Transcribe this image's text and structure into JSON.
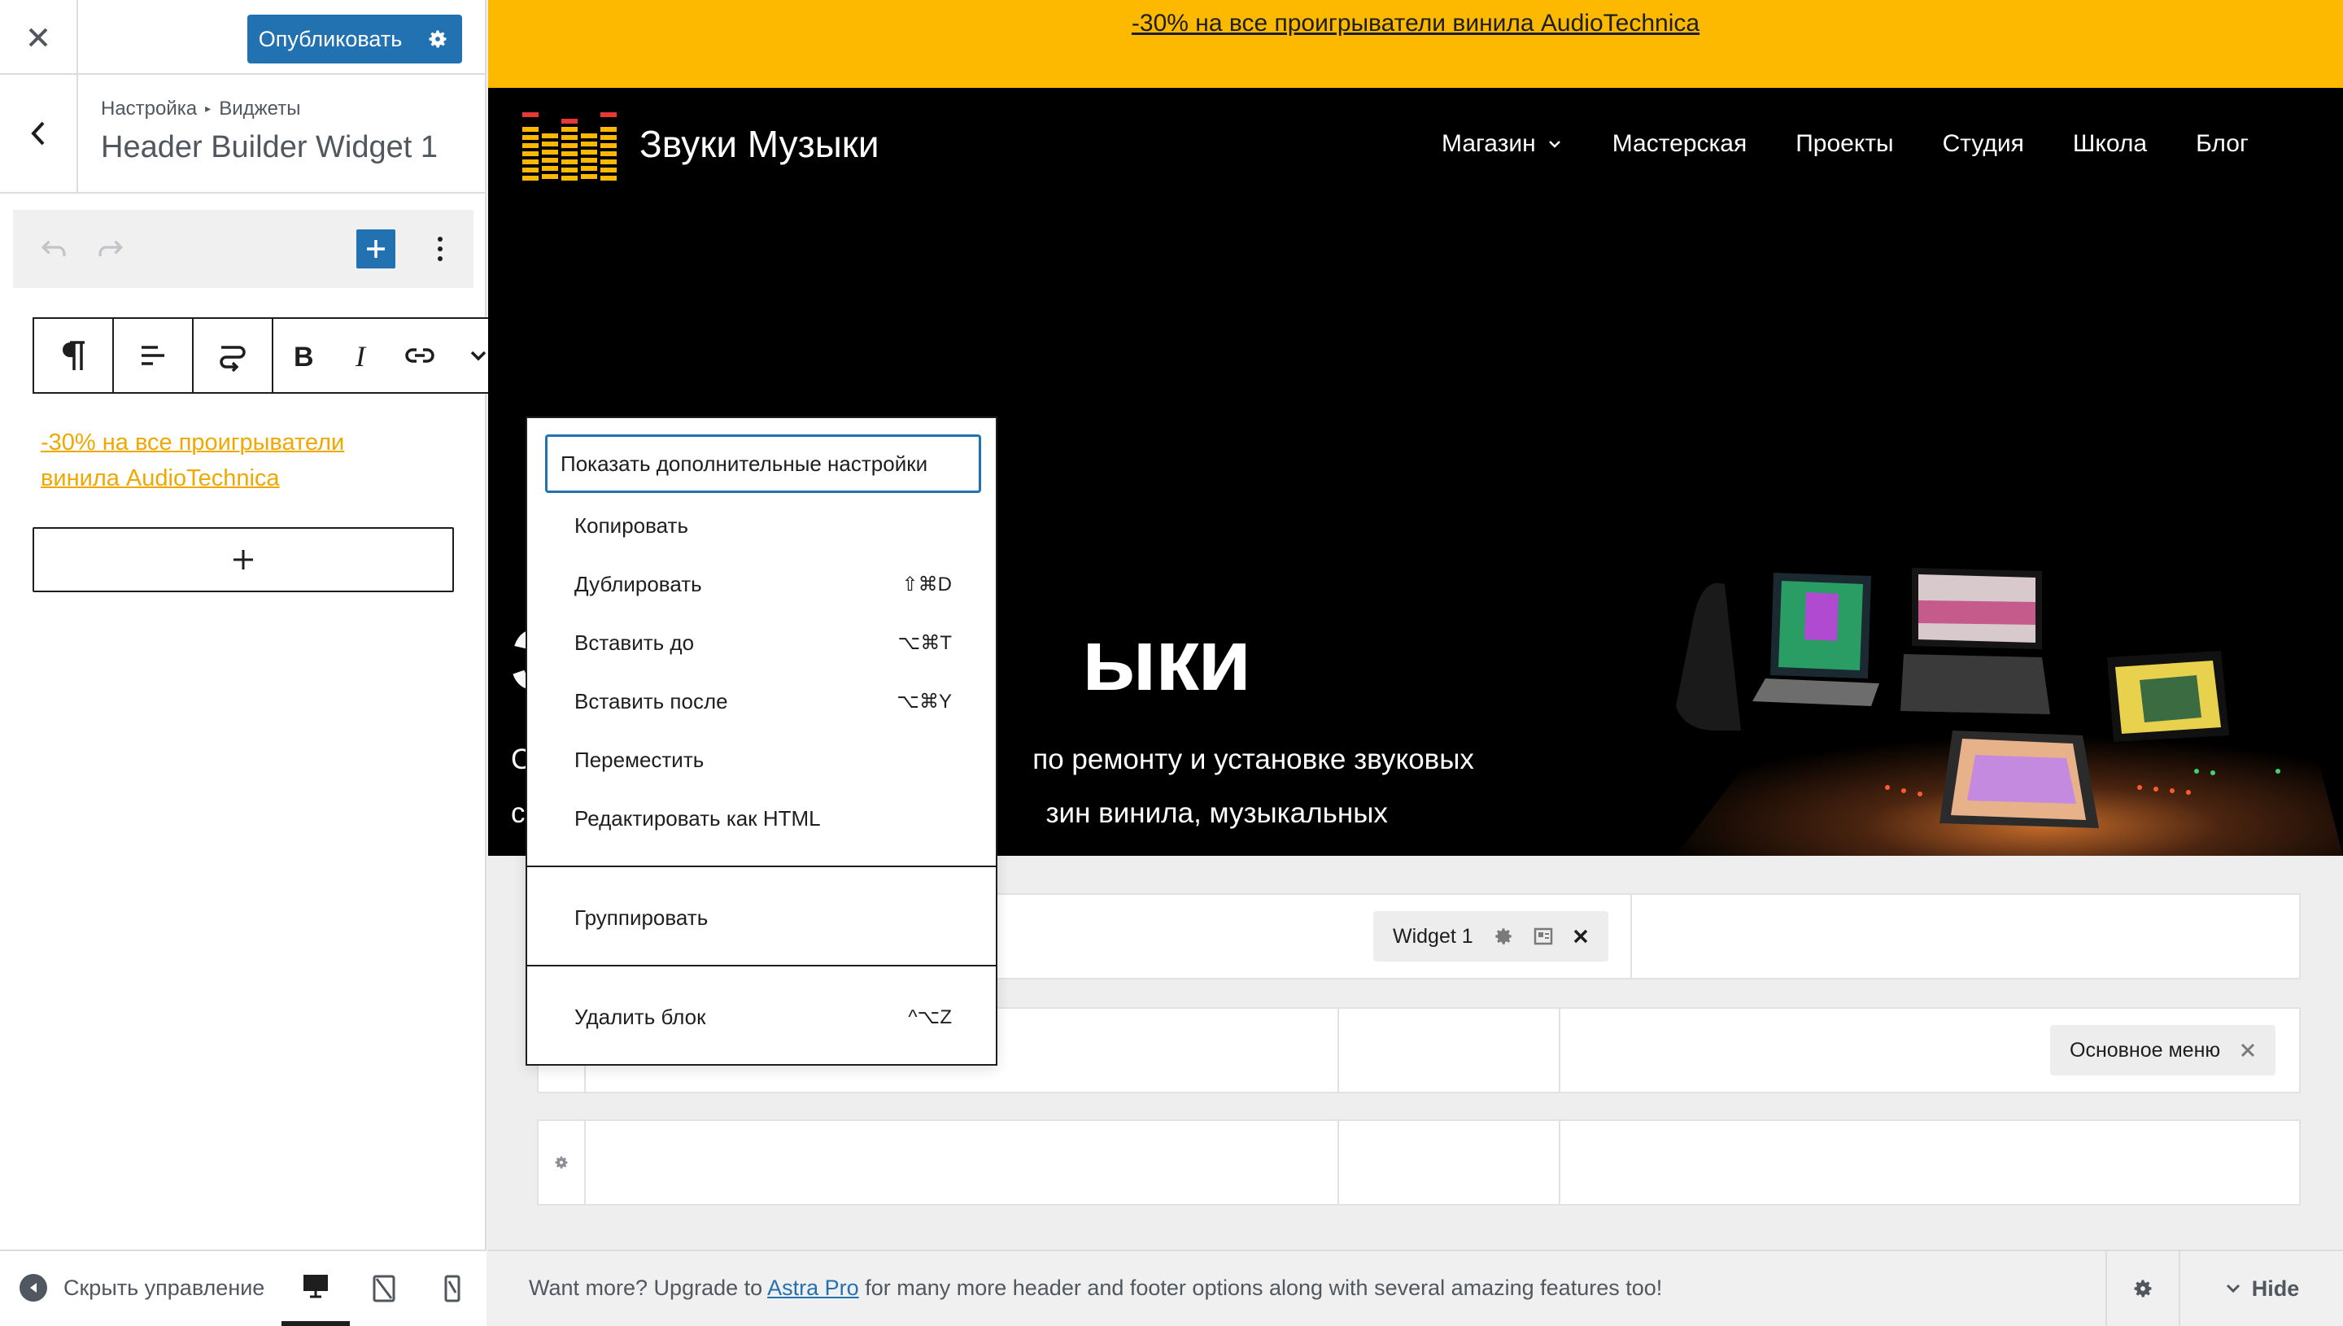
{
  "sidebar": {
    "publish_label": "Опубликовать",
    "breadcrumb": [
      "Настройка",
      "Виджеты"
    ],
    "panel_title": "Header Builder Widget 1",
    "widget_text_line1": "-30% на все проигрыватели",
    "widget_text_line2": "винила AudioTechnica",
    "hide_controls_label": "Скрыть управление",
    "devices": [
      "desktop-icon",
      "tablet-icon",
      "mobile-icon"
    ]
  },
  "preview": {
    "topbar_text": "-30% на все проигрыватели винила AudioTechnica",
    "site_name": "Звуки Музыки",
    "nav": [
      "Магазин",
      "Мастерская",
      "Проекты",
      "Студия",
      "Школа",
      "Блог"
    ],
    "hero_title_start": "З",
    "hero_title_end": "ыки",
    "hero_line1_start": "С",
    "hero_line1_end": "по ремонту и установке звуковых",
    "hero_line2_start": "с",
    "hero_line2_end": "зин винила, музыкальных"
  },
  "builder": {
    "widget_chip": "Widget 1",
    "menu_chip": "Основное меню"
  },
  "context_menu": {
    "items": [
      {
        "label": "Показать дополнительные настройки",
        "shortcut": ""
      },
      {
        "label": "Копировать",
        "shortcut": ""
      },
      {
        "label": "Дублировать",
        "shortcut": "⇧⌘D"
      },
      {
        "label": "Вставить до",
        "shortcut": "⌥⌘T"
      },
      {
        "label": "Вставить после",
        "shortcut": "⌥⌘Y"
      },
      {
        "label": "Переместить",
        "shortcut": ""
      },
      {
        "label": "Редактировать как HTML",
        "shortcut": ""
      },
      {
        "label": "Группировать",
        "shortcut": ""
      },
      {
        "label": "Удалить блок",
        "shortcut": "^⌥Z"
      }
    ]
  },
  "upgrade_bar": {
    "text_before": "Want more? Upgrade to ",
    "link": "Astra Pro",
    "text_after": " for many more header and footer options along with several amazing features too!",
    "hide_label": "Hide"
  },
  "colors": {
    "accent": "#2271b1",
    "topbar": "#fcb900",
    "promo_text": "#f0a800",
    "header_bg": "#000000"
  }
}
